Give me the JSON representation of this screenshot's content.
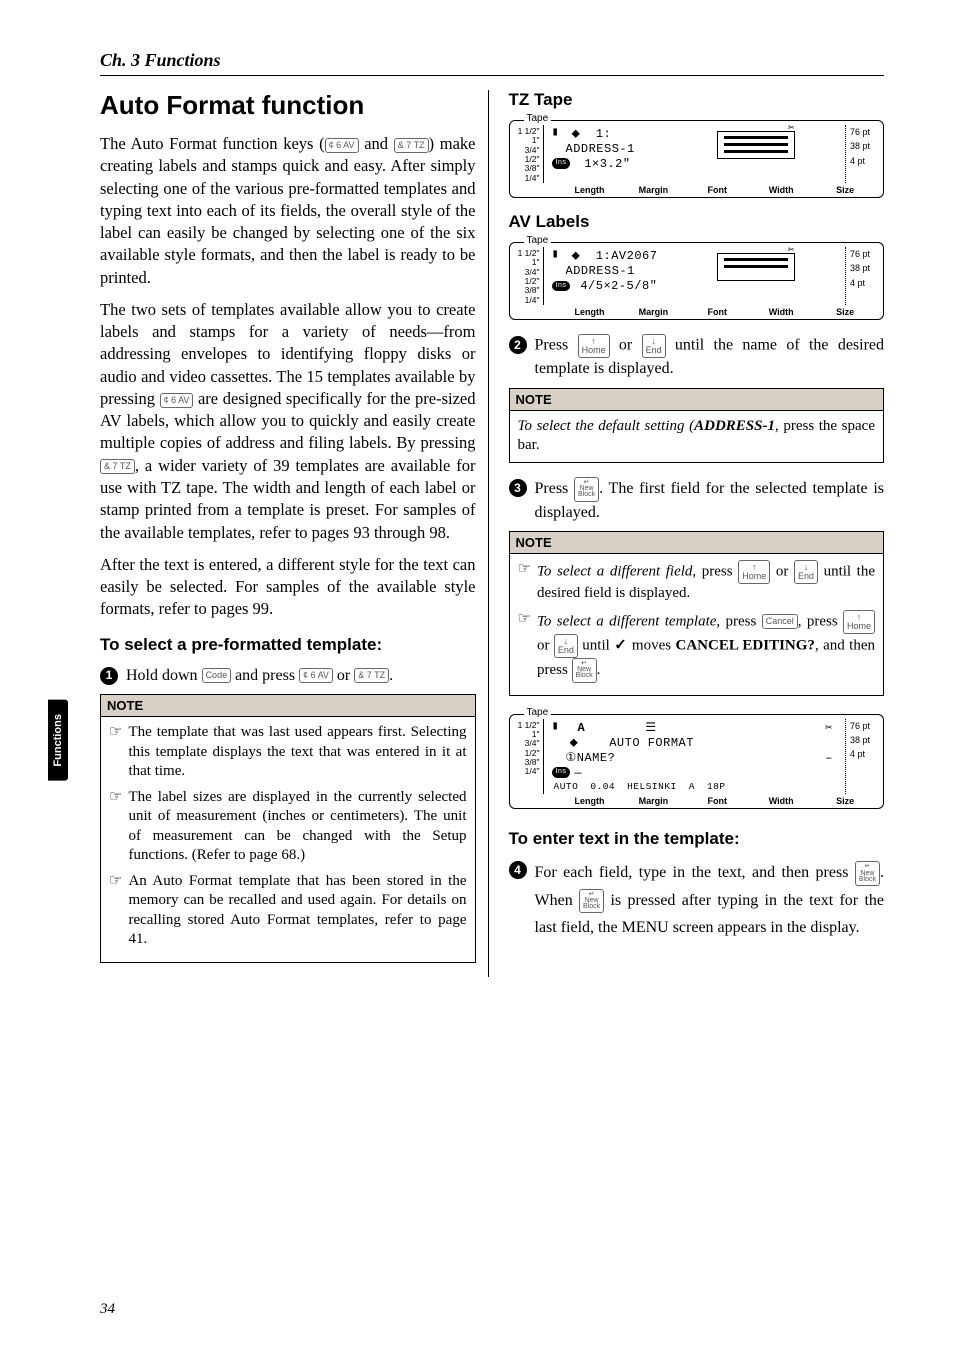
{
  "header": {
    "chapter": "Ch. 3 Functions"
  },
  "sideTab": "Functions",
  "pageNum": "34",
  "left": {
    "title": "Auto Format function",
    "p1a": "The Auto Format function keys (",
    "key6av": "¢\n6 AV",
    "p1b": " and ",
    "key7tz": "&\n7 TZ",
    "p1c": ") make creating labels and stamps quick and easy. After simply selecting one of the various pre-formatted templates and typing text into each of its fields, the overall style of the label can easily be changed by selecting one of the six available style formats, and then the label is ready to be printed.",
    "p2a": "The two sets of templates available allow you to create labels and stamps for a variety of needs—from addressing envelopes to identifying floppy disks or audio and video cassettes. The 15 templates available by pressing ",
    "p2b": " are designed specifically for the pre-sized AV labels, which allow you to quickly and easily create multiple copies of address and filing labels. By pressing ",
    "p2c": ", a wider variety of 39 templates are available for use with TZ tape. The width and length of each label or stamp printed from a template is preset. For samples of the available templates, refer to pages 93 through 98.",
    "p3": "After the text is entered, a different style for the text can easily be selected. For samples of the available style formats, refer to pages 99.",
    "sub1": "To select a pre-formatted template:",
    "step1a": "Hold down ",
    "keyCode": "Code",
    "step1b": " and press ",
    "step1c": " or ",
    "step1d": ".",
    "note1": {
      "head": "NOTE",
      "i1": "The template that was last used appears first. Selecting this template displays the text that was entered in it at that time.",
      "i2": "The label sizes are displayed in the currently selected unit of measurement (inches or centimeters). The unit of measurement can be changed with the Setup functions. (Refer to page 68.)",
      "i3": "An Auto Format template that has been stored in the memory can be recalled and used again. For details on recalling stored Auto Format templates, refer to page 41."
    }
  },
  "right": {
    "tzHead": "TZ Tape",
    "avHead": "AV Labels",
    "lcd": {
      "tape": "Tape",
      "sizes": "1 1/2\"\n1\"\n3/4\"\n1/2\"\n3/8\"\n1/4\"",
      "pts": "76 pt\n38 pt\n4 pt",
      "ins": "Ins",
      "labels": {
        "l1": "Length",
        "l2": "Margin",
        "l3": "Font",
        "l4": "Width",
        "l5": "Size"
      }
    },
    "lcd1": {
      "line1": "1:",
      "line2": "ADDRESS-1",
      "line3": "1×3.2\""
    },
    "lcd2": {
      "line1": "1:AV2067",
      "line2": "ADDRESS-1",
      "line3": "4/5×2-5/8\""
    },
    "step2a": "Press ",
    "keyHome": "↑\nHome",
    "step2b": " or ",
    "keyEnd": "↓\nEnd",
    "step2c": " until the name of the desired template is displayed.",
    "note2": {
      "head": "NOTE",
      "b1": "To select the default setting (",
      "b2": "ADDRESS-1",
      "b3": ", press the space bar."
    },
    "step3a": "Press ",
    "keyEnter": "↵\nNew\nBlock",
    "step3b": ". The first field for the selected template is displayed.",
    "note3": {
      "head": "NOTE",
      "i1a": "To select a different field",
      "i1b": ", press ",
      "i1c": " or ",
      "i1d": " until the desired field is displayed.",
      "i2a": "To select a different template",
      "i2b": ", press ",
      "keyCancel": "Cancel",
      "i2c": ", press ",
      "i2d": " or ",
      "i2e": " until ",
      "i2f": " moves ",
      "i2g": "CANCEL EDITING?",
      "i2h": ", and then press ",
      "i2i": "."
    },
    "lcd3": {
      "rowA": "A",
      "rowTitle": "AUTO FORMAT",
      "rowName": "①NAME?",
      "under": "—",
      "vals": {
        "v1": "AUTO",
        "v2": "0.04",
        "v3": "HELSINKI",
        "v4": "A",
        "v5": "18P"
      }
    },
    "sub2": "To enter text in the template:",
    "step4a": "For each field, type in the text, and then press ",
    "step4b": ". When ",
    "step4c": " is pressed after typing in the text for the last field, the MENU screen appears in the display."
  }
}
